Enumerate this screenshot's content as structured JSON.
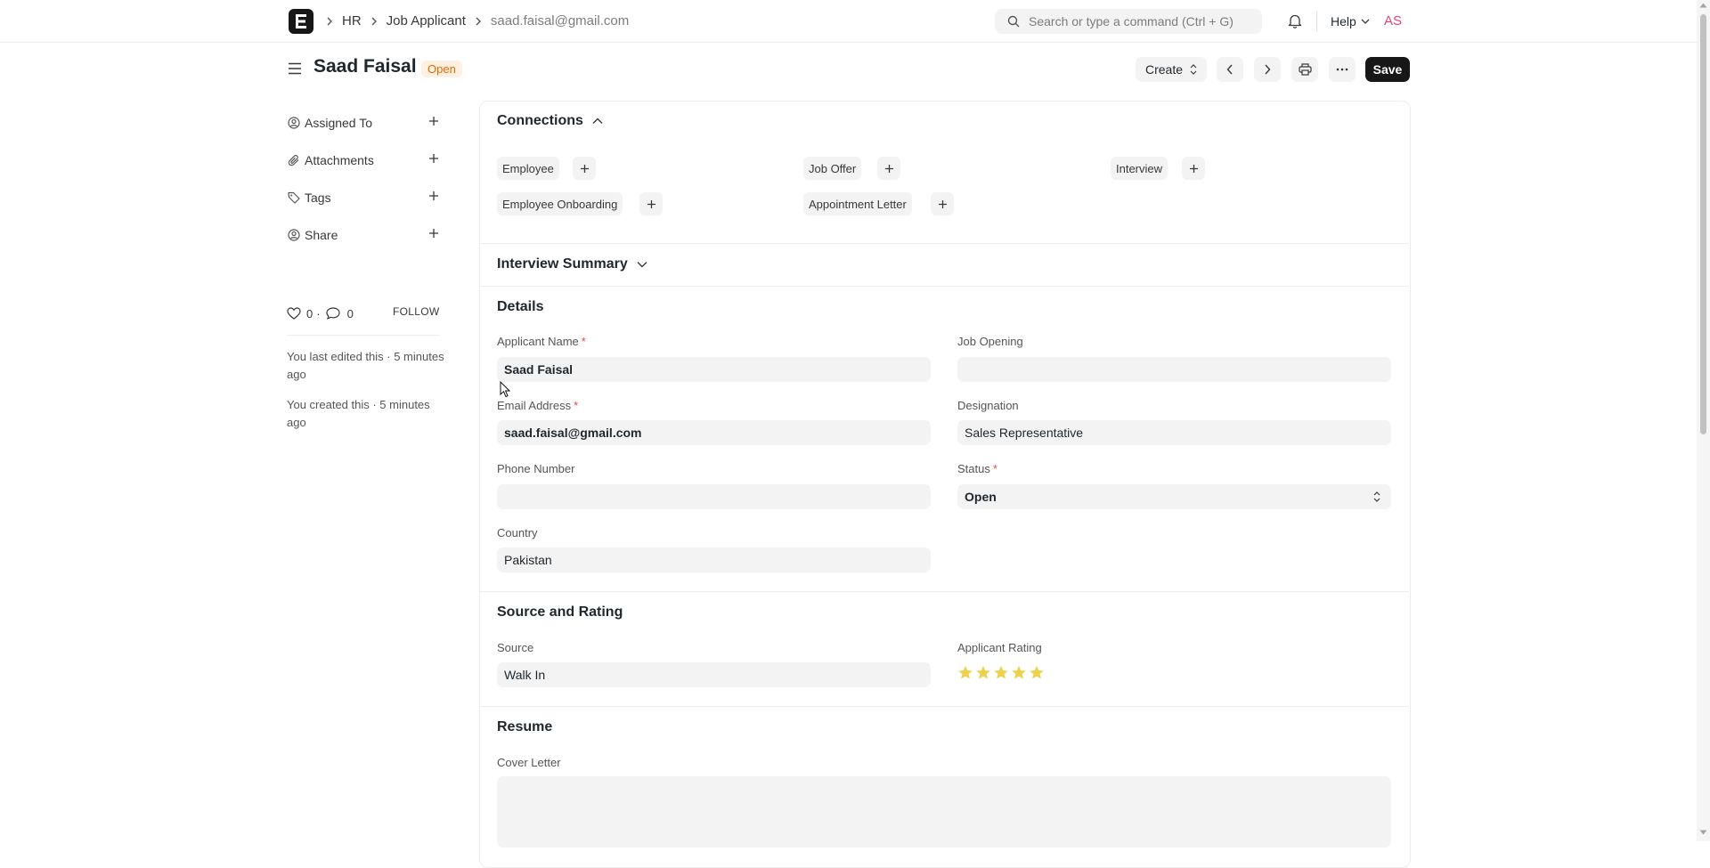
{
  "navbar": {
    "logo_letter": "E",
    "breadcrumbs": [
      "HR",
      "Job Applicant",
      "saad.faisal@gmail.com"
    ],
    "search_placeholder": "Search or type a command (Ctrl + G)",
    "help_label": "Help",
    "avatar_initials": "AS"
  },
  "page": {
    "title": "Saad Faisal",
    "status_badge": "Open",
    "create_label": "Create",
    "save_label": "Save"
  },
  "sidebar": {
    "items": [
      {
        "label": "Assigned To",
        "icon": "assign-icon"
      },
      {
        "label": "Attachments",
        "icon": "paperclip-icon"
      },
      {
        "label": "Tags",
        "icon": "tag-icon"
      },
      {
        "label": "Share",
        "icon": "share-icon"
      }
    ],
    "likes_count": "0",
    "comments_count": "0",
    "separator": "·",
    "follow_label": "FOLLOW",
    "activity": [
      "You last edited this · 5 minutes ago",
      "You created this · 5 minutes ago"
    ]
  },
  "connections": {
    "title": "Connections",
    "items": [
      {
        "label": "Employee"
      },
      {
        "label": "Job Offer"
      },
      {
        "label": "Interview"
      },
      {
        "label": "Employee Onboarding"
      },
      {
        "label": "Appointment Letter"
      }
    ]
  },
  "interview_summary": {
    "title": "Interview Summary"
  },
  "details": {
    "title": "Details",
    "applicant_name_label": "Applicant Name",
    "applicant_name": "Saad Faisal",
    "job_opening_label": "Job Opening",
    "job_opening": "",
    "email_label": "Email Address",
    "email": "saad.faisal@gmail.com",
    "designation_label": "Designation",
    "designation": "Sales Representative",
    "phone_label": "Phone Number",
    "phone": "",
    "status_label": "Status",
    "status": "Open",
    "country_label": "Country",
    "country": "Pakistan",
    "required_mark": "*"
  },
  "source_rating": {
    "title": "Source and Rating",
    "source_label": "Source",
    "source": "Walk In",
    "rating_label": "Applicant Rating",
    "rating": 5,
    "rating_max": 5
  },
  "resume": {
    "title": "Resume",
    "cover_letter_label": "Cover Letter",
    "cover_letter": ""
  },
  "colors": {
    "accent": "#171717",
    "badge_text": "#e46a00",
    "badge_bg": "#fff0e1",
    "star": "#ecd24d",
    "avatar": "#e0437a"
  }
}
